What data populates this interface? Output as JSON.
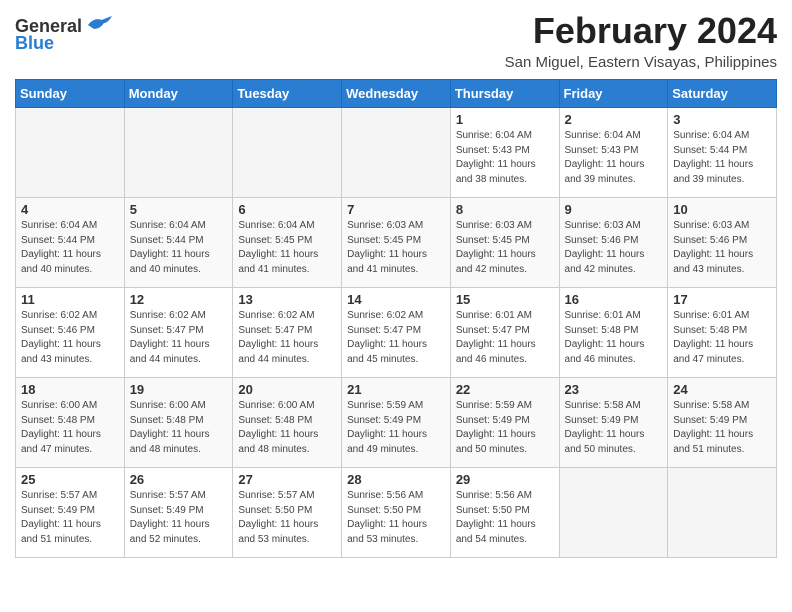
{
  "logo": {
    "general": "General",
    "blue": "Blue"
  },
  "title": "February 2024",
  "subtitle": "San Miguel, Eastern Visayas, Philippines",
  "headers": [
    "Sunday",
    "Monday",
    "Tuesday",
    "Wednesday",
    "Thursday",
    "Friday",
    "Saturday"
  ],
  "weeks": [
    [
      {
        "day": "",
        "info": ""
      },
      {
        "day": "",
        "info": ""
      },
      {
        "day": "",
        "info": ""
      },
      {
        "day": "",
        "info": ""
      },
      {
        "day": "1",
        "info": "Sunrise: 6:04 AM\nSunset: 5:43 PM\nDaylight: 11 hours\nand 38 minutes."
      },
      {
        "day": "2",
        "info": "Sunrise: 6:04 AM\nSunset: 5:43 PM\nDaylight: 11 hours\nand 39 minutes."
      },
      {
        "day": "3",
        "info": "Sunrise: 6:04 AM\nSunset: 5:44 PM\nDaylight: 11 hours\nand 39 minutes."
      }
    ],
    [
      {
        "day": "4",
        "info": "Sunrise: 6:04 AM\nSunset: 5:44 PM\nDaylight: 11 hours\nand 40 minutes."
      },
      {
        "day": "5",
        "info": "Sunrise: 6:04 AM\nSunset: 5:44 PM\nDaylight: 11 hours\nand 40 minutes."
      },
      {
        "day": "6",
        "info": "Sunrise: 6:04 AM\nSunset: 5:45 PM\nDaylight: 11 hours\nand 41 minutes."
      },
      {
        "day": "7",
        "info": "Sunrise: 6:03 AM\nSunset: 5:45 PM\nDaylight: 11 hours\nand 41 minutes."
      },
      {
        "day": "8",
        "info": "Sunrise: 6:03 AM\nSunset: 5:45 PM\nDaylight: 11 hours\nand 42 minutes."
      },
      {
        "day": "9",
        "info": "Sunrise: 6:03 AM\nSunset: 5:46 PM\nDaylight: 11 hours\nand 42 minutes."
      },
      {
        "day": "10",
        "info": "Sunrise: 6:03 AM\nSunset: 5:46 PM\nDaylight: 11 hours\nand 43 minutes."
      }
    ],
    [
      {
        "day": "11",
        "info": "Sunrise: 6:02 AM\nSunset: 5:46 PM\nDaylight: 11 hours\nand 43 minutes."
      },
      {
        "day": "12",
        "info": "Sunrise: 6:02 AM\nSunset: 5:47 PM\nDaylight: 11 hours\nand 44 minutes."
      },
      {
        "day": "13",
        "info": "Sunrise: 6:02 AM\nSunset: 5:47 PM\nDaylight: 11 hours\nand 44 minutes."
      },
      {
        "day": "14",
        "info": "Sunrise: 6:02 AM\nSunset: 5:47 PM\nDaylight: 11 hours\nand 45 minutes."
      },
      {
        "day": "15",
        "info": "Sunrise: 6:01 AM\nSunset: 5:47 PM\nDaylight: 11 hours\nand 46 minutes."
      },
      {
        "day": "16",
        "info": "Sunrise: 6:01 AM\nSunset: 5:48 PM\nDaylight: 11 hours\nand 46 minutes."
      },
      {
        "day": "17",
        "info": "Sunrise: 6:01 AM\nSunset: 5:48 PM\nDaylight: 11 hours\nand 47 minutes."
      }
    ],
    [
      {
        "day": "18",
        "info": "Sunrise: 6:00 AM\nSunset: 5:48 PM\nDaylight: 11 hours\nand 47 minutes."
      },
      {
        "day": "19",
        "info": "Sunrise: 6:00 AM\nSunset: 5:48 PM\nDaylight: 11 hours\nand 48 minutes."
      },
      {
        "day": "20",
        "info": "Sunrise: 6:00 AM\nSunset: 5:48 PM\nDaylight: 11 hours\nand 48 minutes."
      },
      {
        "day": "21",
        "info": "Sunrise: 5:59 AM\nSunset: 5:49 PM\nDaylight: 11 hours\nand 49 minutes."
      },
      {
        "day": "22",
        "info": "Sunrise: 5:59 AM\nSunset: 5:49 PM\nDaylight: 11 hours\nand 50 minutes."
      },
      {
        "day": "23",
        "info": "Sunrise: 5:58 AM\nSunset: 5:49 PM\nDaylight: 11 hours\nand 50 minutes."
      },
      {
        "day": "24",
        "info": "Sunrise: 5:58 AM\nSunset: 5:49 PM\nDaylight: 11 hours\nand 51 minutes."
      }
    ],
    [
      {
        "day": "25",
        "info": "Sunrise: 5:57 AM\nSunset: 5:49 PM\nDaylight: 11 hours\nand 51 minutes."
      },
      {
        "day": "26",
        "info": "Sunrise: 5:57 AM\nSunset: 5:49 PM\nDaylight: 11 hours\nand 52 minutes."
      },
      {
        "day": "27",
        "info": "Sunrise: 5:57 AM\nSunset: 5:50 PM\nDaylight: 11 hours\nand 53 minutes."
      },
      {
        "day": "28",
        "info": "Sunrise: 5:56 AM\nSunset: 5:50 PM\nDaylight: 11 hours\nand 53 minutes."
      },
      {
        "day": "29",
        "info": "Sunrise: 5:56 AM\nSunset: 5:50 PM\nDaylight: 11 hours\nand 54 minutes."
      },
      {
        "day": "",
        "info": ""
      },
      {
        "day": "",
        "info": ""
      }
    ]
  ]
}
